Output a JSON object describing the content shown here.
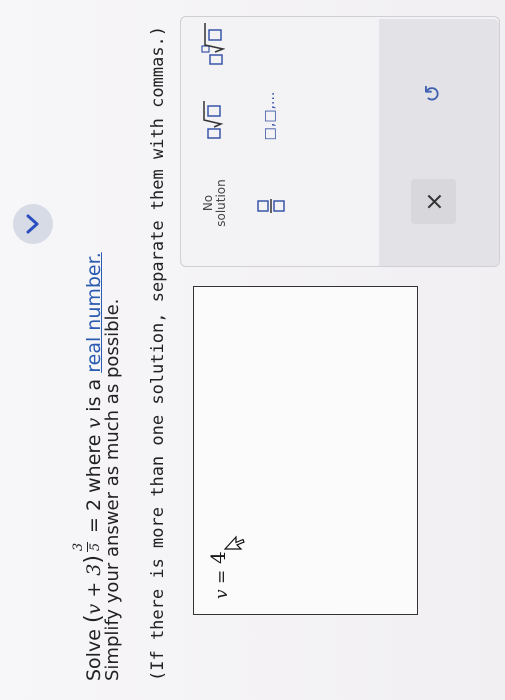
{
  "question": {
    "solve_word": "Solve",
    "base": "v + 3",
    "exp_num": "3",
    "exp_den": "5",
    "equals_rhs": "= 2",
    "where_text": "where",
    "var": "v",
    "is_a": "is a",
    "real_number_link": "real number.",
    "simplify_text": "Simplify your answer as much as possible.",
    "instructions": "(If there is more than one solution, separate them with commas.)"
  },
  "answer": {
    "var_label": "v =",
    "value": "4"
  },
  "palette": {
    "no_solution_line1": "No",
    "no_solution_line2": "solution",
    "list_label": "□,□,...",
    "clear_label": "×",
    "undo_label": "↺"
  },
  "colors": {
    "link": "#2a5bb0",
    "palette_icon": "#3a56a8",
    "chevron_bg": "#d6dbe6"
  },
  "icons": {
    "chevron": "chevron-down-icon",
    "fraction": "fraction-template-icon",
    "sqrt": "square-root-template-icon",
    "nroot": "nth-root-template-icon",
    "clear": "clear-x-icon",
    "undo": "undo-icon"
  }
}
